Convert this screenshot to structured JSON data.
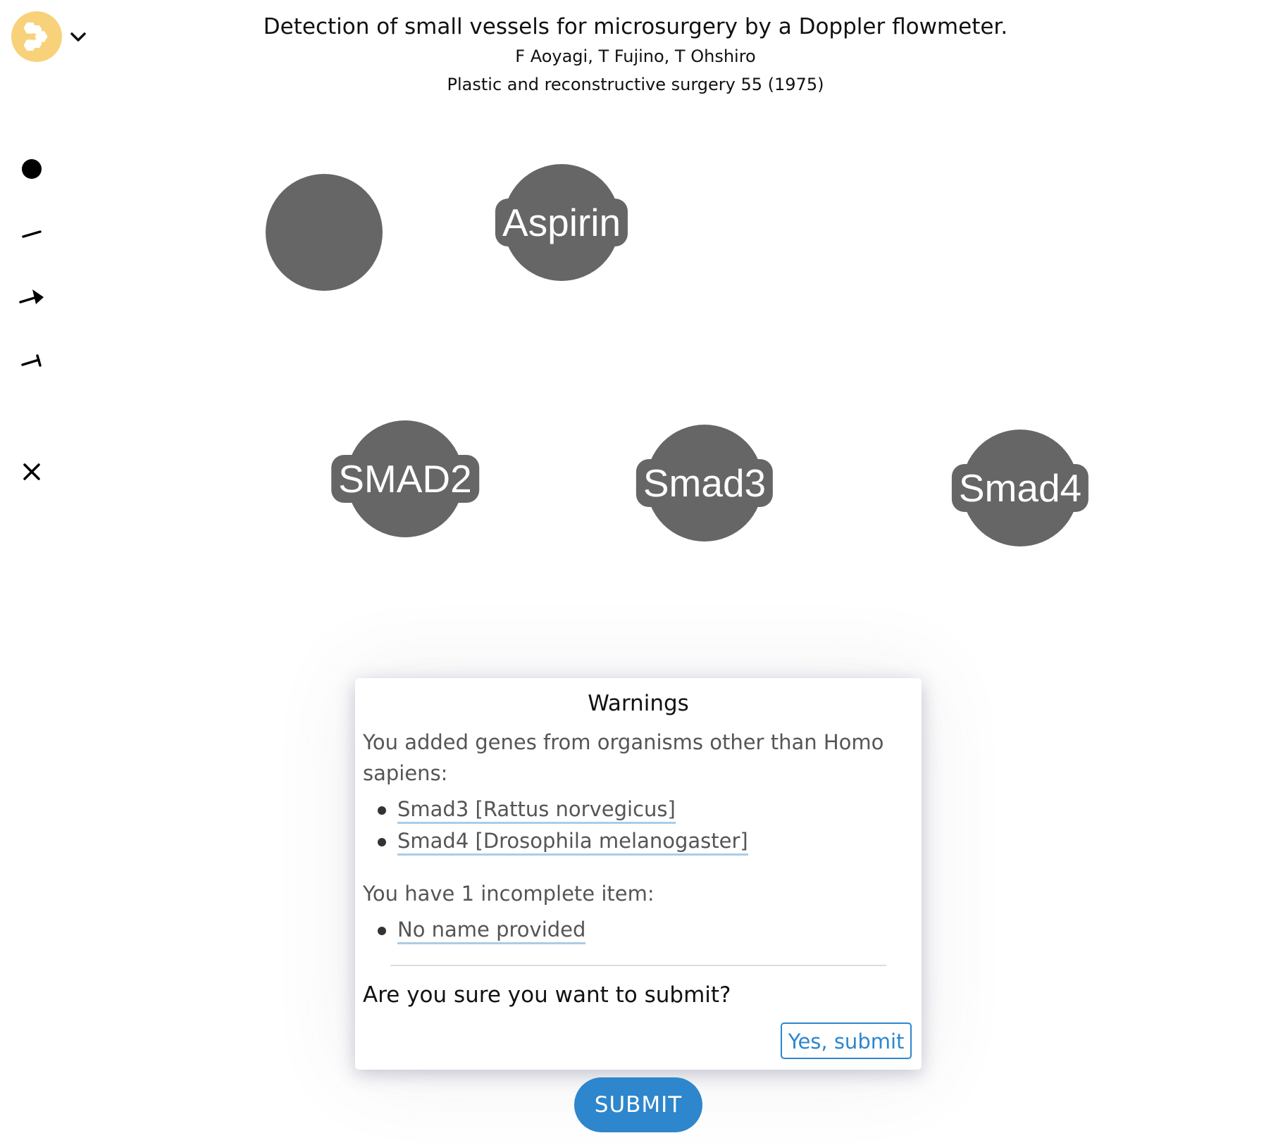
{
  "app": {
    "logo_icon": "honeycomb-logo-icon",
    "logo_color": "#f8d27a",
    "menu_icon": "chevron-down-icon"
  },
  "paper": {
    "title": "Detection of small vessels for microsurgery by a Doppler flowmeter.",
    "authors": "F Aoyagi, T Fujino, T Ohshiro",
    "journal": "Plastic and reconstructive surgery 55 (1975)"
  },
  "toolbar": {
    "tools": [
      {
        "name": "add-node-tool",
        "icon": "filled-circle-icon"
      },
      {
        "name": "add-edge-tool",
        "icon": "line-icon"
      },
      {
        "name": "add-activation-tool",
        "icon": "arrow-icon"
      },
      {
        "name": "add-inhibition-tool",
        "icon": "inhibition-icon"
      },
      {
        "name": "delete-tool",
        "icon": "close-icon"
      }
    ]
  },
  "nodes": [
    {
      "id": "unnamed",
      "label": ""
    },
    {
      "id": "aspirin",
      "label": "Aspirin"
    },
    {
      "id": "smad2",
      "label": "SMAD2"
    },
    {
      "id": "smad3",
      "label": "Smad3"
    },
    {
      "id": "smad4",
      "label": "Smad4"
    }
  ],
  "node_color": "#666666",
  "warnings": {
    "title": "Warnings",
    "organism_text": "You added genes from organisms other than Homo sapiens:",
    "organism_items": [
      "Smad3 [Rattus norvegicus]",
      "Smad4 [Drosophila melanogaster]"
    ],
    "incomplete_text": "You have 1 incomplete item:",
    "incomplete_items": [
      "No name provided"
    ],
    "confirm_text": "Are you sure you want to submit?",
    "confirm_button": "Yes, submit"
  },
  "submit_button": "SUBMIT",
  "accent_color": "#2e86cc"
}
